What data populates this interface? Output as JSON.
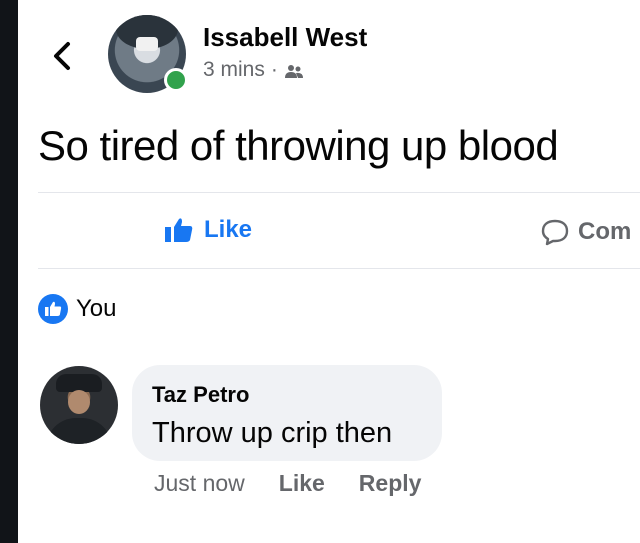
{
  "post": {
    "author": "Issabell West",
    "time": "3 mins",
    "separator": "·",
    "audience_icon": "friends-icon",
    "text": "So tired of throwing up blood",
    "online": true
  },
  "actions": {
    "like_label": "Like",
    "comment_label": "Com"
  },
  "reactions": {
    "icon": "like-badge-icon",
    "by": "You"
  },
  "comment": {
    "author": "Taz Petro",
    "text": "Throw up crip then",
    "time": "Just now",
    "like_label": "Like",
    "reply_label": "Reply"
  },
  "colors": {
    "accent": "#1877f2",
    "online": "#31a24c",
    "muted_text": "#65676b",
    "bubble": "#f0f2f5"
  }
}
